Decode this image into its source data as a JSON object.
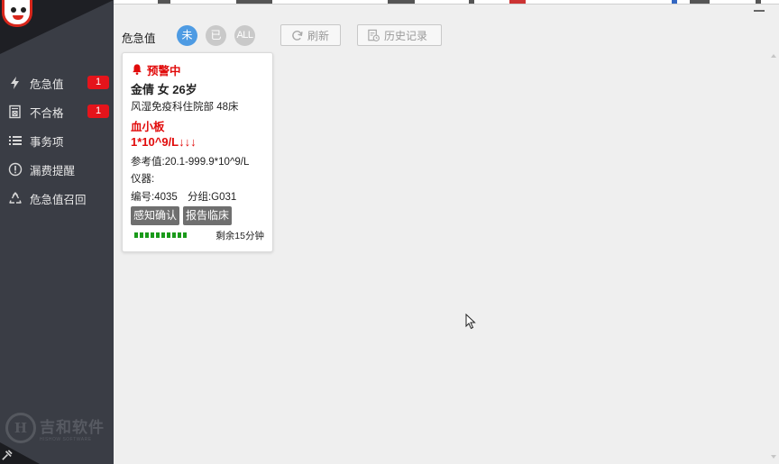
{
  "sidebar": {
    "items": [
      {
        "label": "危急值",
        "badge": "1",
        "icon": "lightning-icon"
      },
      {
        "label": "不合格",
        "badge": "1",
        "icon": "rejected-document-icon"
      },
      {
        "label": "事务项",
        "icon": "list-icon"
      },
      {
        "label": "漏费提醒",
        "icon": "exclamation-circle-icon"
      },
      {
        "label": "危急值召回",
        "icon": "recycle-icon"
      }
    ],
    "brand": {
      "mark": "H",
      "name": "吉和软件",
      "tagline": "HISHOW SOFTWARE"
    }
  },
  "toolbar": {
    "title": "危急值",
    "filters": [
      {
        "label": "未",
        "active": true
      },
      {
        "label": "已",
        "active": false
      },
      {
        "label": "ALL",
        "active": false
      }
    ],
    "refresh_label": "刷新",
    "history_label": "历史记录"
  },
  "alert_card": {
    "status": "预警中",
    "patient": "金倩 女 26岁",
    "department": "风湿免疫科住院部 48床",
    "item_name": "血小板",
    "item_value": "1*10^9/L↓↓↓",
    "reference": "参考值:20.1-999.9*10^9/L",
    "device": "仪器:",
    "code": "编号:4035",
    "group": "分组:G031",
    "actions": {
      "acknowledge": "感知确认",
      "report": "报告临床"
    },
    "remaining_time": "剩余15分钟",
    "progress_segments": 10
  },
  "colors": {
    "accent": "#4e9be3",
    "alert_red": "#e10b0b",
    "badge_red": "#e5141b",
    "sidebar_bg": "#3a3d45",
    "progress_green": "#1a9a1a"
  }
}
